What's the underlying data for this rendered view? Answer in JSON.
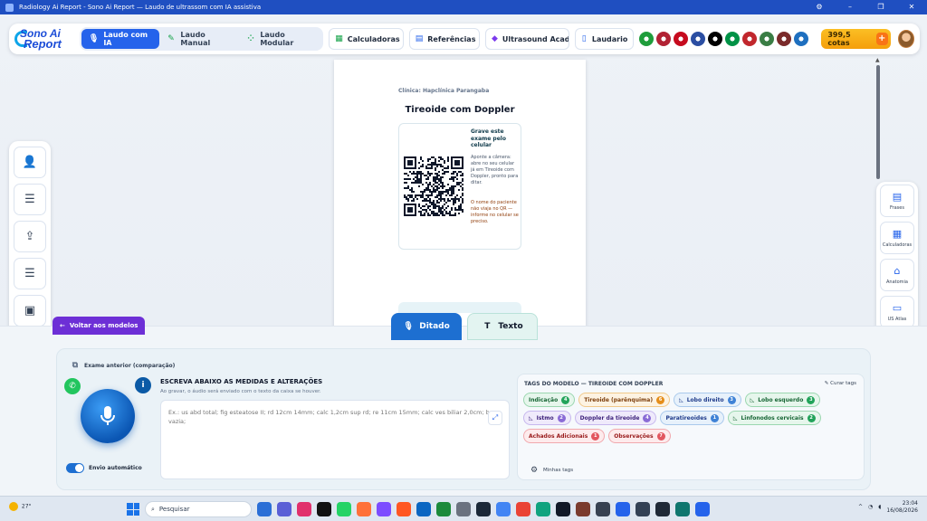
{
  "window": {
    "title": "Radiology Ai Report - Sono Ai Report — Laudo de ultrassom com IA assistiva",
    "controls": [
      "⚙",
      "–",
      "❐",
      "✕"
    ]
  },
  "logo": {
    "line1": "Sono Ai",
    "line2": "Report"
  },
  "topnav": {
    "modes": [
      {
        "label": "Laudo com IA",
        "icon": "microphone-icon",
        "active": true
      },
      {
        "label": "Laudo Manual",
        "icon": "pencil-icon",
        "active": false
      },
      {
        "label": "Laudo Modular",
        "icon": "modules-icon",
        "active": false
      }
    ],
    "links": [
      {
        "label": "Calculadoras",
        "icon": "calculator-icon"
      },
      {
        "label": "Referências",
        "icon": "book-icon"
      },
      {
        "label": "Ultrasound Academ",
        "icon": "graduation-cap-icon"
      },
      {
        "label": "Laudario",
        "icon": "document-icon"
      }
    ],
    "flags": [
      "#1f9d3b",
      "#b22234",
      "#c60b1e",
      "#2b4ea2",
      "#000000",
      "#009246",
      "#c1272d",
      "#3a7d44",
      "#7a2a2a",
      "#1e6fbf"
    ],
    "credits": "399,5 cotas",
    "credits_plus": "+"
  },
  "left_sidebar": {
    "items": [
      {
        "icon": "user-icon",
        "glyph": "👤"
      },
      {
        "icon": "list-icon",
        "glyph": "☰"
      },
      {
        "icon": "upload-icon",
        "glyph": "⇪"
      },
      {
        "icon": "list-icon",
        "glyph": "☰"
      },
      {
        "icon": "camera-icon",
        "glyph": "▣"
      },
      {
        "icon": "chart-icon",
        "glyph": "▥"
      }
    ]
  },
  "right_tools": [
    {
      "label": "Frases",
      "icon": "chat-icon",
      "glyph": "▤"
    },
    {
      "label": "Calculadoras",
      "icon": "calculator-icon",
      "glyph": "▦"
    },
    {
      "label": "Anatomia",
      "icon": "anatomy-icon",
      "glyph": "⌂"
    },
    {
      "label": "US Atlas",
      "icon": "atlas-icon",
      "glyph": "▭"
    }
  ],
  "document": {
    "clinic": "Clínica: Hapclínica Parangaba",
    "title": "Tireoide com Doppler",
    "qr_title": "Grave este exame pelo celular",
    "qr_text": "Aponte a câmera: abre no seu celular já em Tireoide com Doppler, pronto para ditar.",
    "qr_warning": "O nome do paciente não viaja no QR — informe no celular se preciso."
  },
  "back_button": {
    "label": "Voltar aos modelos",
    "arrow": "←"
  },
  "mode_tabs": [
    {
      "label": "Ditado",
      "icon": "dictation-icon",
      "glyph": "🎙",
      "active": true
    },
    {
      "label": "Texto",
      "icon": "text-icon",
      "glyph": "T",
      "active": false
    }
  ],
  "panel": {
    "previous_exam": "Exame anterior (comparação)",
    "dictation_heading": "ESCREVA ABAIXO AS MEDIDAS E ALTERAÇÕES",
    "dictation_sub": "Ao gravar, o áudio será enviado com o texto da caixa se houver.",
    "dictation_placeholder": "Ex.: us abd total; fig esteatose II; rd 12cm 14mm; calc 1,2cm sup rd; re 11cm 15mm; calc ves biliar 2,0cm; bex vazia;",
    "auto_send": "Envio automático",
    "tags_heading": "TAGS DO MODELO — TIREOIDE COM DOPPLER",
    "curate_tags": "✎ Curar tags",
    "my_tags": "Minhas tags",
    "tags": [
      {
        "label": "Indicação",
        "count": "4",
        "color": "green",
        "icon": ""
      },
      {
        "label": "Tireoide (parênquima)",
        "count": "6",
        "color": "orange",
        "icon": ""
      },
      {
        "label": "Lobo direito",
        "count": "3",
        "color": "blue",
        "icon": "◺"
      },
      {
        "label": "Lobo esquerdo",
        "count": "3",
        "color": "green",
        "icon": "◺"
      },
      {
        "label": "Istmo",
        "count": "2",
        "color": "purple",
        "icon": "◺"
      },
      {
        "label": "Doppler da tireoide",
        "count": "4",
        "color": "purple",
        "icon": ""
      },
      {
        "label": "Paratireoides",
        "count": "1",
        "color": "blue",
        "icon": ""
      },
      {
        "label": "Linfonodos cervicais",
        "count": "2",
        "color": "green",
        "icon": "◺"
      },
      {
        "label": "Achados Adicionais",
        "count": "1",
        "color": "red",
        "icon": ""
      },
      {
        "label": "Observações",
        "count": "7",
        "color": "red",
        "icon": ""
      }
    ]
  },
  "taskbar": {
    "weather": "27°",
    "search_placeholder": "Pesquisar",
    "time": "23:04",
    "date": "16/08/2026",
    "app_colors": [
      "#2b6fd6",
      "#5a5fd6",
      "#e1306c",
      "#111111",
      "#25d366",
      "#ff7139",
      "#7c4dff",
      "#ff5722",
      "#0a66c2",
      "#1c8a3b",
      "#6b7280",
      "#1b2838",
      "#4285f4",
      "#ea4335",
      "#10a37f",
      "#111827",
      "#7a3b2e",
      "#374151",
      "#2563eb",
      "#334155",
      "#1f2937",
      "#0f766e",
      "#2563eb"
    ]
  }
}
